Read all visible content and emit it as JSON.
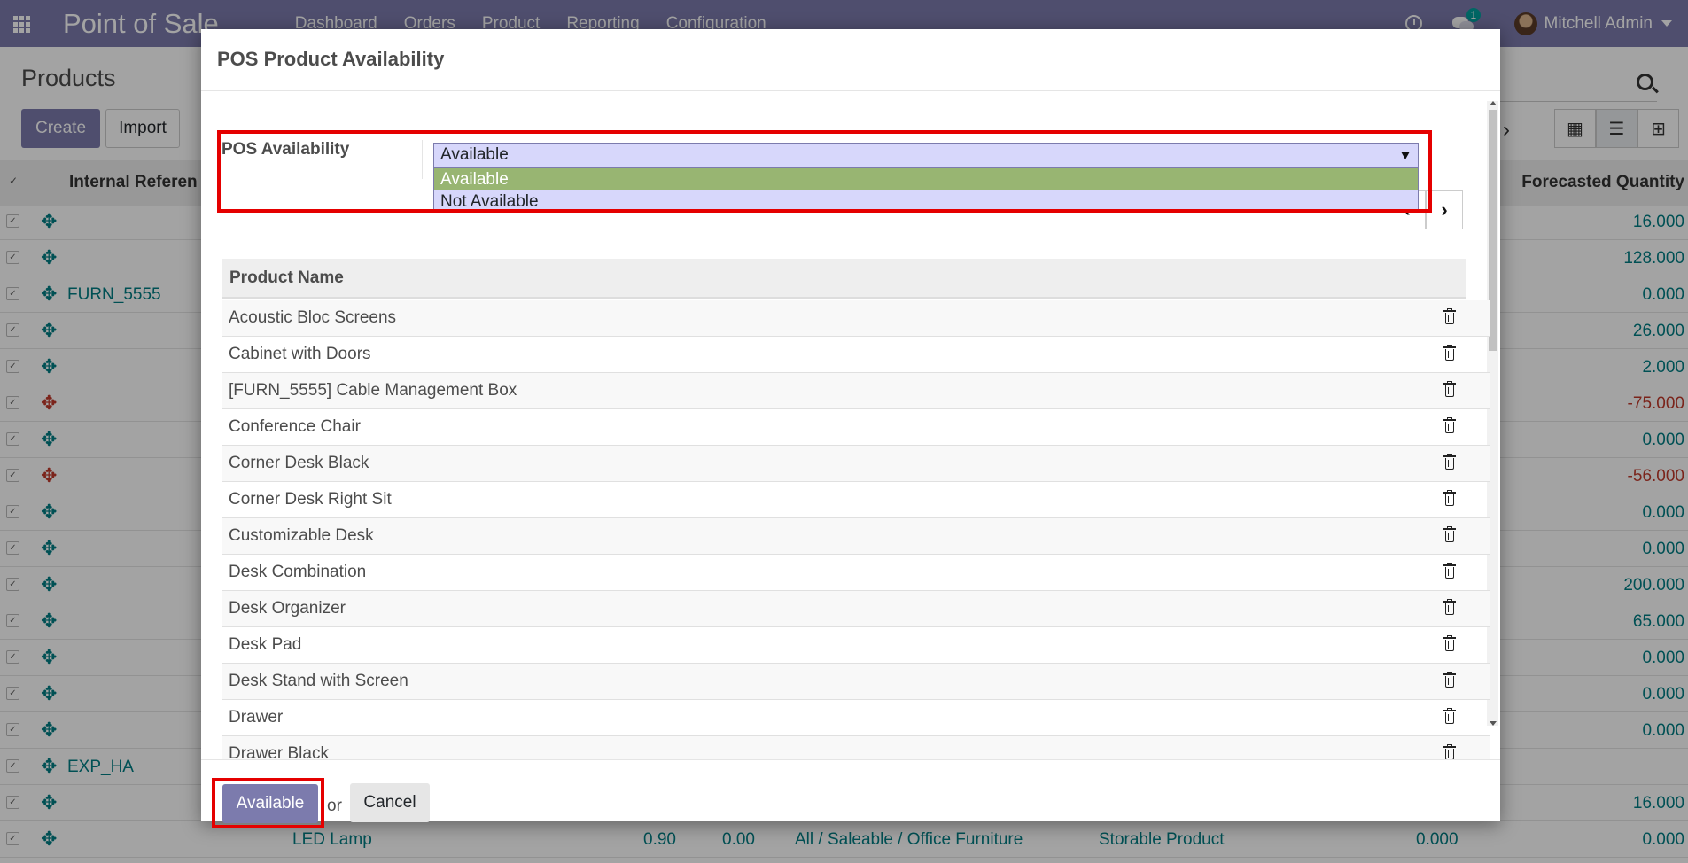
{
  "navbar": {
    "brand": "Point of Sale",
    "menu": [
      "Dashboard",
      "Orders",
      "Product",
      "Reporting",
      "Configuration"
    ],
    "chat_count": "1",
    "user_name": "Mitchell Admin"
  },
  "control_panel": {
    "title": "Products",
    "create_label": "Create",
    "import_label": "Import"
  },
  "list": {
    "columns": {
      "internal_reference": "Internal Referen",
      "forecasted_quantity": "Forecasted Quantity"
    },
    "rows": [
      {
        "ref": "",
        "forecast": "16.000",
        "negative": false
      },
      {
        "ref": "",
        "forecast": "128.000",
        "negative": false
      },
      {
        "ref": "FURN_5555",
        "forecast": "0.000",
        "negative": false
      },
      {
        "ref": "",
        "forecast": "26.000",
        "negative": false
      },
      {
        "ref": "",
        "forecast": "2.000",
        "negative": false
      },
      {
        "ref": "",
        "forecast": "-75.000",
        "negative": true
      },
      {
        "ref": "",
        "forecast": "0.000",
        "negative": false
      },
      {
        "ref": "",
        "forecast": "-56.000",
        "negative": true
      },
      {
        "ref": "",
        "forecast": "0.000",
        "negative": false
      },
      {
        "ref": "",
        "forecast": "0.000",
        "negative": false
      },
      {
        "ref": "",
        "forecast": "200.000",
        "negative": false
      },
      {
        "ref": "",
        "forecast": "65.000",
        "negative": false
      },
      {
        "ref": "",
        "forecast": "0.000",
        "negative": false
      },
      {
        "ref": "",
        "forecast": "0.000",
        "negative": false
      },
      {
        "ref": "",
        "forecast": "0.000",
        "negative": false
      },
      {
        "ref": "EXP_HA",
        "forecast": "",
        "negative": false
      },
      {
        "ref": "",
        "forecast": "16.000",
        "negative": false
      }
    ],
    "last_row": {
      "name": "LED Lamp",
      "sales_price": "0.90",
      "cost": "0.00",
      "category": "All / Saleable / Office Furniture",
      "type": "Storable Product",
      "on_hand": "0.000",
      "forecast": "0.000"
    }
  },
  "modal": {
    "title": "POS Product Availability",
    "field_label": "POS Availability",
    "select_value": "Available",
    "options": [
      "Available",
      "Not Available"
    ],
    "table_header": "Product Name",
    "products": [
      "Acoustic Bloc Screens",
      "Cabinet with Doors",
      "[FURN_5555] Cable Management Box",
      "Conference Chair",
      "Corner Desk Black",
      "Corner Desk Right Sit",
      "Customizable Desk",
      "Desk Combination",
      "Desk Organizer",
      "Desk Pad",
      "Desk Stand with Screen",
      "Drawer",
      "Drawer Black"
    ],
    "footer": {
      "primary_label": "Available",
      "or_text": "or",
      "cancel_label": "Cancel"
    }
  },
  "colors": {
    "brand": "#7c7bad",
    "link": "#017e84",
    "negative": "#c0392b",
    "highlight": "#e50000",
    "selected_option": "#98b572",
    "option_bg": "#d7d7fb"
  }
}
